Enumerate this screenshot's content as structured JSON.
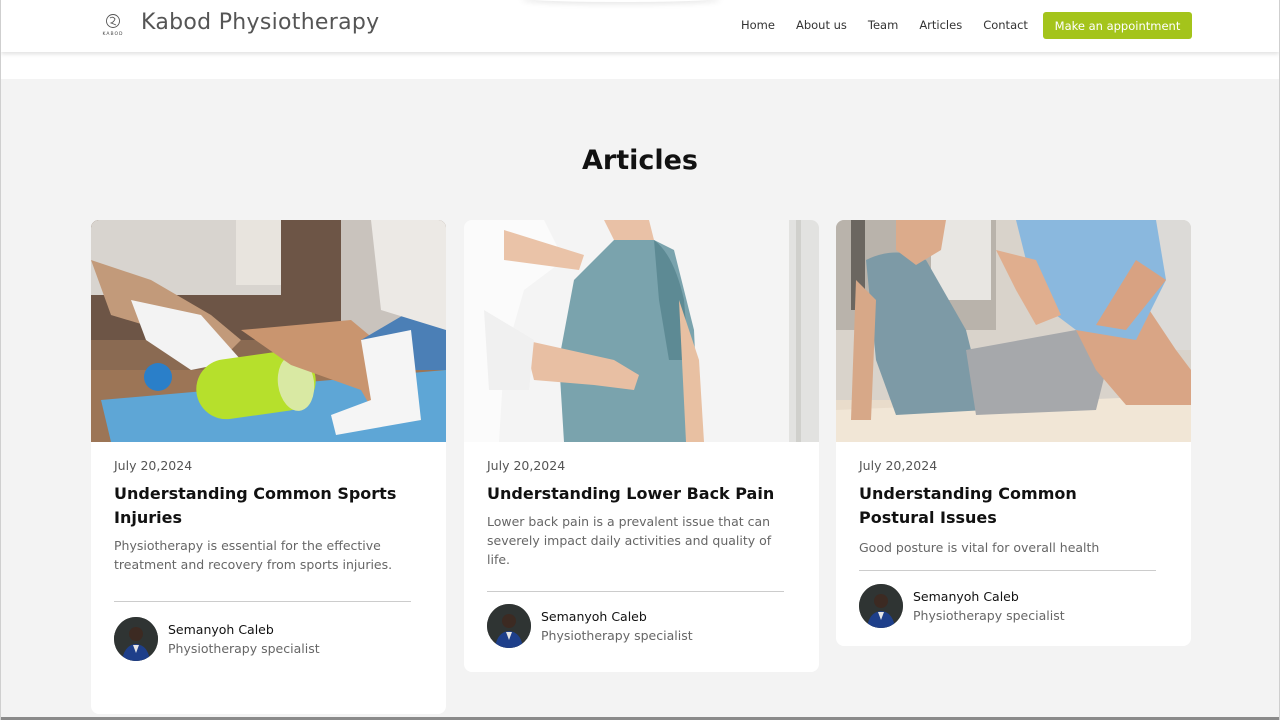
{
  "header": {
    "logo_text": "KABOD",
    "brand": "Kabod Physiotherapy",
    "nav": [
      "Home",
      "About us",
      "Team",
      "Articles",
      "Contact"
    ],
    "cta": "Make an appointment",
    "accent_color": "#a4c41b"
  },
  "main": {
    "title": "Articles",
    "articles": [
      {
        "date": "July 20,2024",
        "title": "Understanding Common Sports Injuries",
        "excerpt": "Physiotherapy is essential for the effective treatment and recovery from sports injuries.",
        "author_name": "Semanyoh Caleb",
        "author_role": "Physiotherapy specialist",
        "image_icon": "foam-roller-therapy-photo"
      },
      {
        "date": "July 20,2024",
        "title": "Understanding Lower Back Pain",
        "excerpt": "Lower back pain is a prevalent issue that can severely impact daily activities and quality of life.",
        "author_name": "Semanyoh Caleb",
        "author_role": "Physiotherapy specialist",
        "image_icon": "back-examination-photo"
      },
      {
        "date": "July 20,2024",
        "title": "Understanding Common Postural Issues",
        "excerpt": "Good posture is vital for overall health",
        "author_name": "Semanyoh Caleb",
        "author_role": "Physiotherapy specialist",
        "image_icon": "knee-therapy-photo"
      }
    ]
  }
}
